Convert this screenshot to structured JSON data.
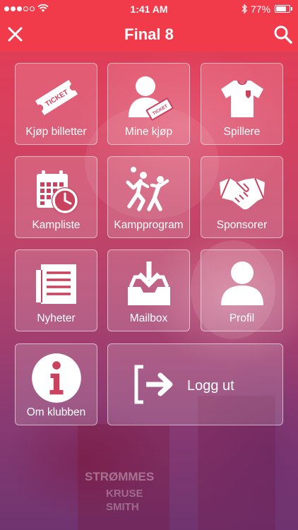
{
  "status_bar": {
    "time": "1:41 AM",
    "battery": "77%",
    "battery_level": 0.77,
    "signal_bars": 5,
    "signal_filled": 3
  },
  "nav": {
    "title": "Final 8",
    "close_icon": "close-icon",
    "search_icon": "search-icon"
  },
  "menu": {
    "items": [
      {
        "label": "Kjøp billetter",
        "icon": "ticket-icon"
      },
      {
        "label": "Mine kjøp",
        "icon": "user-ticket-icon"
      },
      {
        "label": "Spillere",
        "icon": "jersey-icon"
      },
      {
        "label": "Kampliste",
        "icon": "calendar-clock-icon"
      },
      {
        "label": "Kampprogram",
        "icon": "handball-players-icon"
      },
      {
        "label": "Sponsorer",
        "icon": "handshake-icon"
      },
      {
        "label": "Nyheter",
        "icon": "news-icon"
      },
      {
        "label": "Mailbox",
        "icon": "inbox-icon"
      },
      {
        "label": "Profil",
        "icon": "profile-icon"
      },
      {
        "label": "Om klubben",
        "icon": "info-icon"
      },
      {
        "label": "Logg ut",
        "icon": "logout-icon"
      }
    ]
  },
  "ticket_text": "TICKET",
  "colors": {
    "header": "#f23b4a",
    "tile_bg": "rgba(255,255,255,0.16)",
    "tile_border": "rgba(255,255,255,0.55)"
  }
}
